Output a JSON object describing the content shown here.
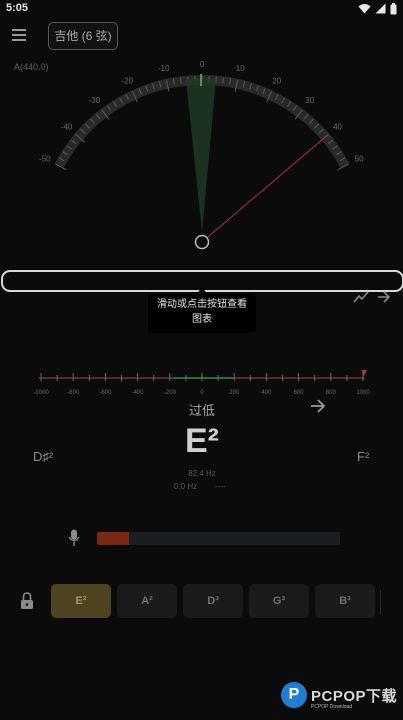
{
  "status_bar": {
    "time": "5:05"
  },
  "header": {
    "instrument": "吉他 (6 弦)",
    "reference": "A(440.0)"
  },
  "gauge": {
    "ticks": [
      "-50",
      "-40",
      "-30",
      "-20",
      "-10",
      "0",
      "10",
      "20",
      "30",
      "40",
      "50"
    ],
    "needle_cents": 40
  },
  "tooltip": {
    "line1": "滑动或点击按钮查看",
    "line2": "图表"
  },
  "cents_scale": {
    "labels": [
      "-1000",
      "-800",
      "-600",
      "-400",
      "-200",
      "0",
      "200",
      "400",
      "600",
      "800",
      "1000"
    ]
  },
  "tuning": {
    "status": "过低",
    "note": "E²",
    "prev_note": "D♯²",
    "next_note": "F²",
    "target_freq": "82.4 Hz",
    "detected_freq": "0.0 Hz",
    "detected_extra": "----"
  },
  "input_level": 0.13,
  "strings": [
    {
      "label": "E²",
      "active": true
    },
    {
      "label": "A²",
      "active": false
    },
    {
      "label": "D³",
      "active": false
    },
    {
      "label": "G³",
      "active": false
    },
    {
      "label": "B³",
      "active": false
    }
  ],
  "watermark": {
    "brand": "PCPOP下载",
    "sub": "PCPOP Download"
  },
  "colors": {
    "accent": "#4e4320",
    "level": "#7a2812",
    "needle": "#b0304a"
  }
}
